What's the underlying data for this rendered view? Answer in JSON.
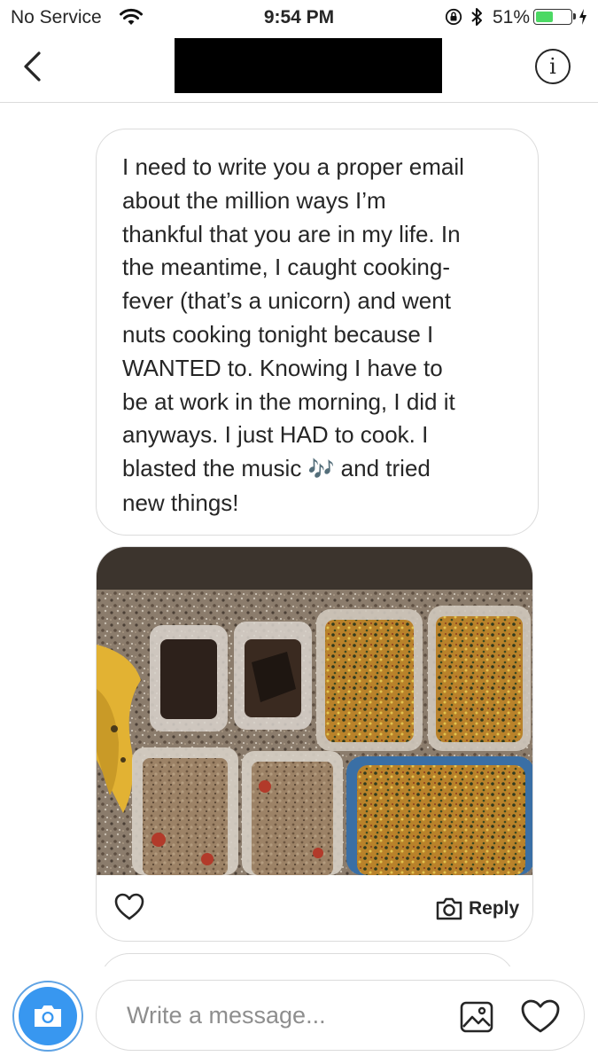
{
  "status_bar": {
    "carrier": "No Service",
    "time": "9:54 PM",
    "battery_percent": "51%",
    "battery_level": 0.51,
    "icons": [
      "wifi-icon",
      "orientation-lock-icon",
      "bluetooth-icon",
      "battery-icon",
      "charging-bolt-icon"
    ]
  },
  "header": {
    "back_icon": "chevron-left-icon",
    "info_label": "i",
    "name_redacted": true
  },
  "messages": [
    {
      "type": "text",
      "text": "I need to write you a proper email\nabout the million ways I’m\nthankful that you are in my life. In\nthe meantime, I caught cooking-\nfever (that’s a unicorn) and went\nnuts cooking tonight because I\nWANTED to. Knowing I have to\nbe at work in the morning, I did it\nanyways. I just HAD to cook. I\nblasted the music ",
      "emoji": "🎶",
      "text_end": " and tried\nnew things!"
    },
    {
      "type": "photo",
      "photo_description_icon": "meal-prep-photo",
      "like_icon": "heart-outline-icon",
      "reply_label": "Reply",
      "reply_icon": "camera-outline-icon"
    }
  ],
  "composer": {
    "camera_icon": "camera-icon",
    "placeholder": "Write a message...",
    "gallery_icon": "image-icon",
    "heart_icon": "heart-outline-icon"
  },
  "colors": {
    "accent_blue": "#3897f0",
    "border": "#dbdbdb",
    "text": "#262626",
    "placeholder": "#8e8e8e",
    "battery_green": "#4cd964"
  }
}
